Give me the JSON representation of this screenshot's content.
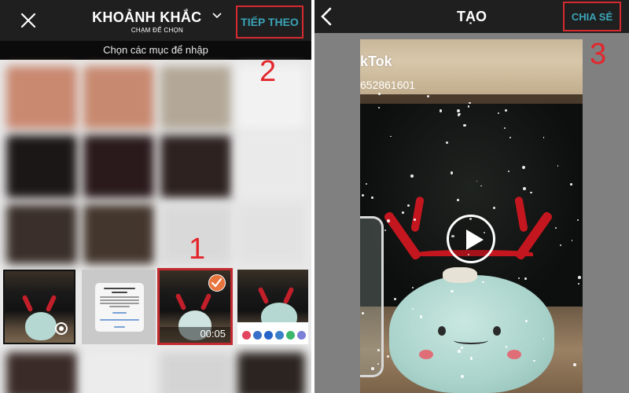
{
  "left_screen": {
    "header": {
      "close_icon": "close-icon",
      "title": "KHOẢNH KHẮC",
      "title_dropdown_icon": "chevron-down-icon",
      "subtitle": "CHẠM ĐỂ CHỌN",
      "next_button": "TIẾP THEO"
    },
    "instruction": "Chọn các mục để nhập",
    "selected_thumbnail": {
      "duration": "00:05",
      "checked": true,
      "check_icon": "checkmark-icon"
    },
    "thumbnails": [
      {
        "kind": "video",
        "badge_icon": "live-photo-icon"
      },
      {
        "kind": "permission-dialog-screenshot"
      },
      {
        "kind": "video",
        "selected": true
      },
      {
        "kind": "share-sheet-screenshot"
      }
    ]
  },
  "right_screen": {
    "header": {
      "back_icon": "chevron-left-icon",
      "title": "TẠO",
      "share_button": "CHIA SẺ"
    },
    "video_preview": {
      "watermark_text": "kTok",
      "watermark_id": "652861601",
      "play_icon": "play-icon"
    }
  },
  "annotations": [
    {
      "label": "1"
    },
    {
      "label": "2"
    },
    {
      "label": "3"
    }
  ],
  "colors": {
    "accent_teal": "#3aa4b8",
    "annotation_red": "#e3262c",
    "header_dark": "#1f1f1f",
    "check_orange": "#e8743e"
  }
}
